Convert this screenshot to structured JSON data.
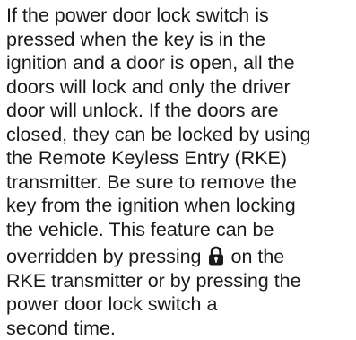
{
  "paragraph": {
    "lines": [
      "If the power door lock switch is",
      "pressed when the key is in the",
      "ignition and a door is open, all the",
      "doors will lock and only the driver",
      "door will unlock. If the doors are",
      "closed, they can be locked by using",
      "the Remote Keyless Entry (RKE)",
      "transmitter. Be sure to remove the",
      "key from the ignition when locking",
      "the vehicle. This feature can be"
    ],
    "icon_line_before": "overridden by pressing",
    "icon_line_after": "on the",
    "icon": "lock-icon",
    "tail_lines": [
      "RKE transmitter or by pressing the",
      "power door lock switch a",
      "second time."
    ]
  }
}
